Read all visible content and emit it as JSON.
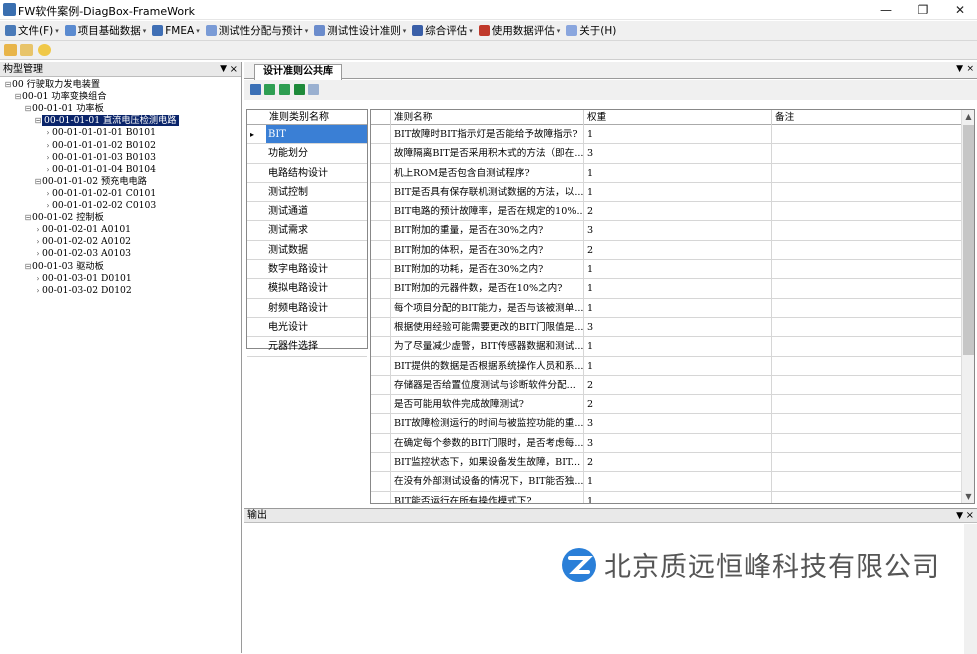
{
  "window": {
    "title": "FW软件案例-DiagBox-FrameWork"
  },
  "menu": [
    {
      "label": "文件(F)",
      "icon": "file-icon",
      "color": "#4a7ab8"
    },
    {
      "label": "项目基础数据",
      "icon": "project-icon",
      "color": "#5b8bd0"
    },
    {
      "label": "FMEA",
      "icon": "fmea-icon",
      "color": "#3f6fb5"
    },
    {
      "label": "测试性分配与预计",
      "icon": "allocation-icon",
      "color": "#7a9bd6"
    },
    {
      "label": "测试性设计准则",
      "icon": "criteria-icon",
      "color": "#6b8ccc"
    },
    {
      "label": "综合评估",
      "icon": "evaluation-icon",
      "color": "#3a5fa8"
    },
    {
      "label": "使用数据评估",
      "icon": "usage-data-icon",
      "color": "#c0392b"
    },
    {
      "label": "关于(H)",
      "icon": "about-icon",
      "color": "#8aa6de"
    }
  ],
  "left_panel": {
    "title": "构型管理",
    "tree": [
      {
        "label": "00  行驶取力发电装置",
        "level": 0
      },
      {
        "label": "00-01  功率变换组合",
        "level": 1
      },
      {
        "label": "00-01-01  功率板",
        "level": 2
      },
      {
        "label": "00-01-01-01  直流电压检测电路",
        "level": 3,
        "selected": true
      },
      {
        "label": "00-01-01-01-01  B0101",
        "level": 4
      },
      {
        "label": "00-01-01-01-02  B0102",
        "level": 4
      },
      {
        "label": "00-01-01-01-03  B0103",
        "level": 4
      },
      {
        "label": "00-01-01-01-04  B0104",
        "level": 4
      },
      {
        "label": "00-01-01-02  预充电电路",
        "level": 3
      },
      {
        "label": "00-01-01-02-01  C0101",
        "level": 4
      },
      {
        "label": "00-01-01-02-02  C0103",
        "level": 4
      },
      {
        "label": "00-01-02  控制板",
        "level": 2
      },
      {
        "label": "00-01-02-01  A0101",
        "level": 3
      },
      {
        "label": "00-01-02-02  A0102",
        "level": 3
      },
      {
        "label": "00-01-02-03  A0103",
        "level": 3
      },
      {
        "label": "00-01-03  驱动板",
        "level": 2
      },
      {
        "label": "00-01-03-01  D0101",
        "level": 3
      },
      {
        "label": "00-01-03-02  D0102",
        "level": 3
      }
    ]
  },
  "tab": {
    "label": "设计准则公共库"
  },
  "category_grid": {
    "header": "准则类别名称",
    "rows": [
      "BIT",
      "功能划分",
      "电路结构设计",
      "测试控制",
      "测试通道",
      "测试需求",
      "测试数据",
      "数字电路设计",
      "模拟电路设计",
      "射频电路设计",
      "电光设计",
      "元器件选择"
    ]
  },
  "criteria_grid": {
    "headers": [
      "准则名称",
      "权重",
      "备注"
    ],
    "rows": [
      {
        "name": "BIT故障时BIT指示灯是否能给予故障指示?",
        "weight": "1",
        "note": ""
      },
      {
        "name": "故障隔离BIT是否采用积木式的方法（即在...",
        "weight": "3",
        "note": ""
      },
      {
        "name": "机上ROM是否包含自测试程序?",
        "weight": "1",
        "note": ""
      },
      {
        "name": "BIT是否具有保存联机测试数据的方法，以...",
        "weight": "1",
        "note": ""
      },
      {
        "name": "BIT电路的预计故障率，是否在规定的10%...",
        "weight": "2",
        "note": ""
      },
      {
        "name": "BIT附加的重量，是否在30%之内?",
        "weight": "3",
        "note": ""
      },
      {
        "name": "BIT附加的体积，是否在30%之内?",
        "weight": "2",
        "note": ""
      },
      {
        "name": "BIT附加的功耗，是否在30%之内?",
        "weight": "1",
        "note": ""
      },
      {
        "name": "BIT附加的元器件数，是否在10%之内?",
        "weight": "1",
        "note": ""
      },
      {
        "name": "每个项目分配的BIT能力，是否与该被测单...",
        "weight": "1",
        "note": ""
      },
      {
        "name": "根据使用经验可能需要更改的BIT门限值是...",
        "weight": "3",
        "note": ""
      },
      {
        "name": "为了尽量减少虚警，BIT传感器数据和测试...",
        "weight": "1",
        "note": ""
      },
      {
        "name": "BIT提供的数据是否根据系统操作人员和系...",
        "weight": "1",
        "note": ""
      },
      {
        "name": "存储器是否给置位度测试与诊断软件分配...",
        "weight": "2",
        "note": ""
      },
      {
        "name": "是否可能用软件完成故障测试?",
        "weight": "2",
        "note": ""
      },
      {
        "name": "BIT故障检测运行的时间与被监控功能的重...",
        "weight": "3",
        "note": ""
      },
      {
        "name": "在确定每个参数的BIT门限时，是否考虑每...",
        "weight": "3",
        "note": ""
      },
      {
        "name": "BIT监控状态下，如果设备发生故障，BIT...",
        "weight": "2",
        "note": ""
      },
      {
        "name": "在没有外部测试设备的情况下，BIT能否独...",
        "weight": "1",
        "note": ""
      },
      {
        "name": "BIT能否运行在所有操作模式下?",
        "weight": "1",
        "note": ""
      }
    ]
  },
  "output_panel": {
    "title": "输出"
  },
  "watermark": {
    "text": "北京质远恒峰科技有限公司"
  }
}
